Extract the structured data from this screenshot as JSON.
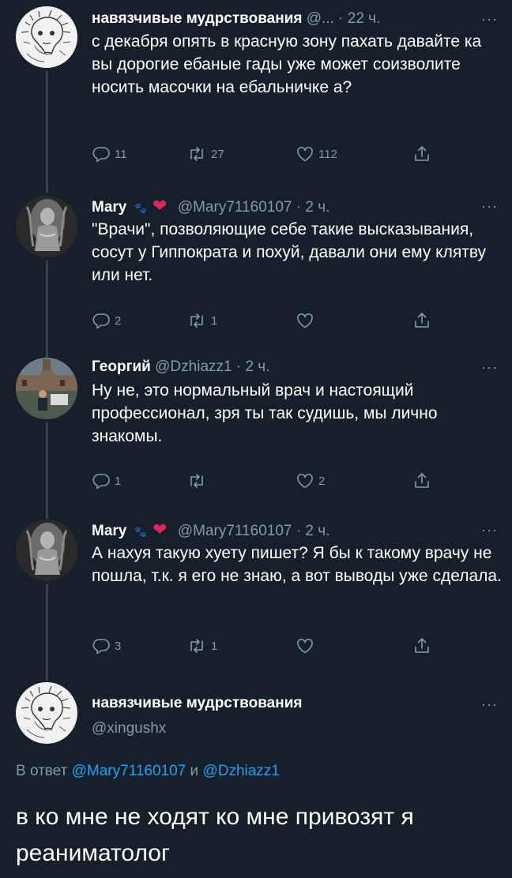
{
  "tweets": [
    {
      "name": "навязчивые мудрствования",
      "handle": "@...",
      "time": "· 22 ч.",
      "text": "с декабря опять в красную зону пахать давайте ка вы дорогие ебаные гады уже может соизволите носить масочки на ебальничке а?",
      "replies": "11",
      "retweets": "27",
      "likes": "112"
    },
    {
      "name": "Mary",
      "handle": "@Mary71160107",
      "time": "· 2 ч.",
      "text": "\"Врачи\", позволяющие себе такие высказывания, сосут у Гиппократа и похуй, давали они ему клятву или нет.",
      "replies": "2",
      "retweets": "1",
      "likes": ""
    },
    {
      "name": "Георгий",
      "handle": "@Dzhiazz1",
      "time": "· 2 ч.",
      "text": "Ну не, это нормальный врач и настоящий профессионал, зря ты так судишь, мы лично знакомы.",
      "replies": "1",
      "retweets": "",
      "likes": "2"
    },
    {
      "name": "Mary",
      "handle": "@Mary71160107",
      "time": "· 2 ч.",
      "text": "А нахуя такую хуету пишет? Я бы к такому врачу не пошла, т.к. я его не знаю, а вот выводы уже сделала.",
      "replies": "3",
      "retweets": "1",
      "likes": ""
    }
  ],
  "main": {
    "name": "навязчивые мудрствования",
    "handle": "@xingushx",
    "reply_prefix": "В ответ",
    "reply_user1": "@Mary71160107",
    "reply_and": "и",
    "reply_user2": "@Dzhiazz1",
    "text": "в ко мне не ходят ко мне привозят я реаниматолог"
  },
  "icons": {
    "reply": "reply-icon",
    "retweet": "retweet-icon",
    "like": "like-icon",
    "share": "share-icon",
    "more": "more-icon",
    "paw": "paw-icon",
    "heart": "heart-icon"
  },
  "colors": {
    "background": "#15202b",
    "secondary_text": "#8899a6",
    "link": "#1da1f2",
    "heart": "#e0245e",
    "thread_line": "#38444d"
  }
}
